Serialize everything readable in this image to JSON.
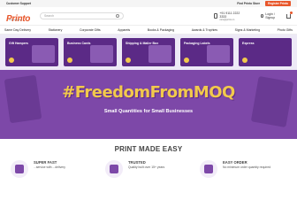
{
  "topbar": {
    "support": "Customer Support",
    "store": "Find Printo Store",
    "register": "Register Printo"
  },
  "header": {
    "logo": "Printo",
    "logo_tag": "Print made easy",
    "search_placeholder": "Search",
    "phone": "+91 9111 2222 3333",
    "email": "care@printo.in",
    "login": "Login / Signup"
  },
  "nav": {
    "items": [
      "Same Day Delivery",
      "Stationery",
      "Corporate Gifts",
      "Apparels",
      "Books & Packaging",
      "Awards & Trophies",
      "Signs & Marketing",
      "Photo Gifts"
    ]
  },
  "tiles": [
    "Gift Hampers",
    "Business Cards",
    "Shipping & Mailer Box",
    "Packaging Labels",
    "Express"
  ],
  "banner": {
    "headline": "#FreedomFromMOQ",
    "subline": "Small Quantities for Small Businesses"
  },
  "section_title": "PRINT MADE EASY",
  "features": [
    {
      "title": "SUPER FAST",
      "desc": "...service with ...delivery",
      "icon": "delivery-icon",
      "color": "#7d48a8"
    },
    {
      "title": "TRUSTED",
      "desc": "Quality built over 15+ years",
      "icon": "handshake-icon",
      "color": "#7d48a8"
    },
    {
      "title": "EASY ORDER",
      "desc": "No minimum order quantity required",
      "icon": "box-icon",
      "color": "#7d48a8"
    }
  ],
  "colors": {
    "brand": "#e8562a",
    "purple": "#7d48a8",
    "yellow": "#f2c94c"
  }
}
